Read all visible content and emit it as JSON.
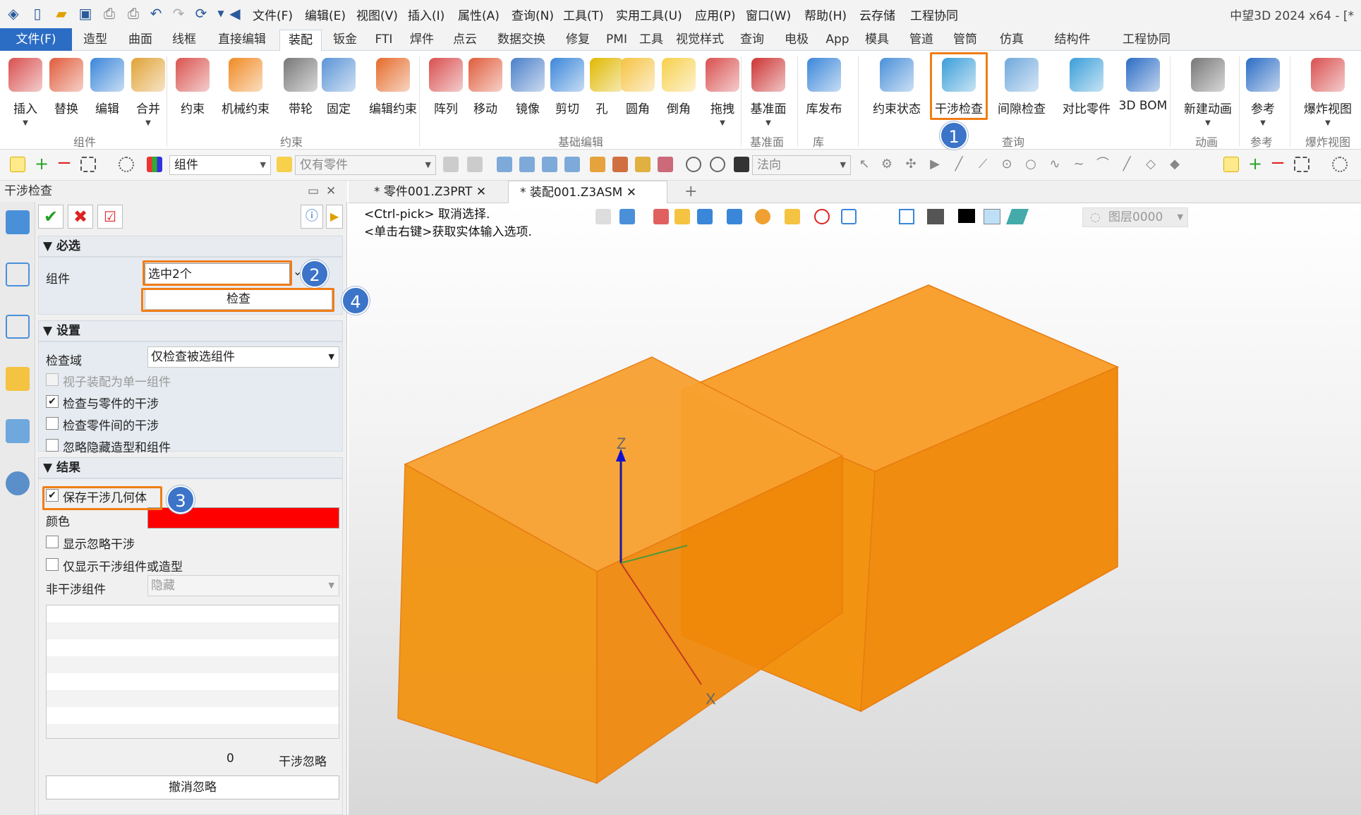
{
  "menu": [
    "文件(F)",
    "编辑(E)",
    "视图(V)",
    "插入(I)",
    "属性(A)",
    "查询(N)",
    "工具(T)",
    "实用工具(U)",
    "应用(P)",
    "窗口(W)",
    "帮助(H)",
    "云存储",
    "工程协同"
  ],
  "app_title": "中望3D 2024 x64 - [*",
  "tabs": [
    "文件(F)",
    "造型",
    "曲面",
    "线框",
    "直接编辑",
    "装配",
    "钣金",
    "FTI",
    "焊件",
    "点云",
    "数据交换",
    "修复",
    "PMI",
    "工具",
    "视觉样式",
    "查询",
    "电极",
    "App",
    "模具",
    "管道",
    "管筒",
    "仿真",
    "结构件",
    "工程协同"
  ],
  "active_tab": "装配",
  "ribbon": {
    "buttons": [
      {
        "label": "插入",
        "icon": "insert-icon",
        "dd": true
      },
      {
        "label": "替换",
        "icon": "replace-icon"
      },
      {
        "label": "编辑",
        "icon": "edit-icon"
      },
      {
        "label": "合并",
        "icon": "merge-icon",
        "dd": true
      },
      {
        "label": "约束",
        "icon": "constraint-icon"
      },
      {
        "label": "机械约束",
        "icon": "mech-constraint-icon"
      },
      {
        "label": "带轮",
        "icon": "pulley-icon"
      },
      {
        "label": "固定",
        "icon": "fix-icon"
      },
      {
        "label": "编辑约束",
        "icon": "edit-constraint-icon"
      },
      {
        "label": "阵列",
        "icon": "pattern-icon"
      },
      {
        "label": "移动",
        "icon": "move-icon"
      },
      {
        "label": "镜像",
        "icon": "mirror-icon"
      },
      {
        "label": "剪切",
        "icon": "cut-icon"
      },
      {
        "label": "孔",
        "icon": "hole-icon"
      },
      {
        "label": "圆角",
        "icon": "fillet-icon"
      },
      {
        "label": "倒角",
        "icon": "chamfer-icon"
      },
      {
        "label": "拖拽",
        "icon": "drag-icon",
        "dd": true
      },
      {
        "label": "基准面",
        "icon": "datum-plane-icon",
        "dd": true
      },
      {
        "label": "库发布",
        "icon": "library-publish-icon"
      },
      {
        "label": "约束状态",
        "icon": "constraint-status-icon"
      },
      {
        "label": "干涉检查",
        "icon": "interference-check-icon"
      },
      {
        "label": "间隙检查",
        "icon": "clearance-check-icon"
      },
      {
        "label": "对比零件",
        "icon": "compare-parts-icon"
      },
      {
        "label": "3D BOM",
        "icon": "bom-icon"
      },
      {
        "label": "新建动画",
        "icon": "new-animation-icon",
        "dd": true
      },
      {
        "label": "参考",
        "icon": "reference-icon",
        "dd": true
      },
      {
        "label": "爆炸视图",
        "icon": "explode-view-icon",
        "dd": true
      }
    ],
    "groups": [
      "组件",
      "约束",
      "基础编辑",
      "基准面",
      "库",
      "查询",
      "动画",
      "参考",
      "爆炸视图"
    ]
  },
  "toolbar2": {
    "filter_value": "组件",
    "scope_value": "仅有零件",
    "direction_value": "法向"
  },
  "panel": {
    "title": "干涉检查",
    "sections": {
      "required": "必选",
      "settings": "设置",
      "results": "结果"
    },
    "component_label": "组件",
    "component_value": "选中2个",
    "check_button": "检查",
    "scope_label": "检查域",
    "scope_value": "仅检查被选组件",
    "options": [
      {
        "label": "视子装配为单一组件",
        "checked": false,
        "disabled": true
      },
      {
        "label": "检查与零件的干涉",
        "checked": true,
        "disabled": false
      },
      {
        "label": "检查零件间的干涉",
        "checked": false,
        "disabled": false
      },
      {
        "label": "忽略隐藏造型和组件",
        "checked": false,
        "disabled": false
      }
    ],
    "save_geometry_label": "保存干涉几何体",
    "save_geometry_checked": true,
    "color_label": "颜色",
    "color_value": "#ff0000",
    "show_ignored_label": "显示忽略干涉",
    "only_show_label": "仅显示干涉组件或造型",
    "non_interference_label": "非干涉组件",
    "non_interference_value": "隐藏",
    "count_value": "0",
    "ignore_label": "干涉忽略",
    "undo_ignore_button": "撤消忽略"
  },
  "doc_tabs": [
    "* 零件001.Z3PRT",
    "* 装配001.Z3ASM"
  ],
  "active_doc": "* 装配001.Z3ASM",
  "viewport": {
    "hint1": "<Ctrl-pick> 取消选择.",
    "hint2": "<单击右键>获取实体输入选项.",
    "layer": "图层0000",
    "axis_z": "Z",
    "axis_x": "X"
  },
  "badges": [
    "1",
    "2",
    "3",
    "4"
  ],
  "colors": {
    "accent": "#2b6cc4",
    "highlight": "#f07d16",
    "badge": "#3b74c8",
    "block": "#f29411"
  }
}
